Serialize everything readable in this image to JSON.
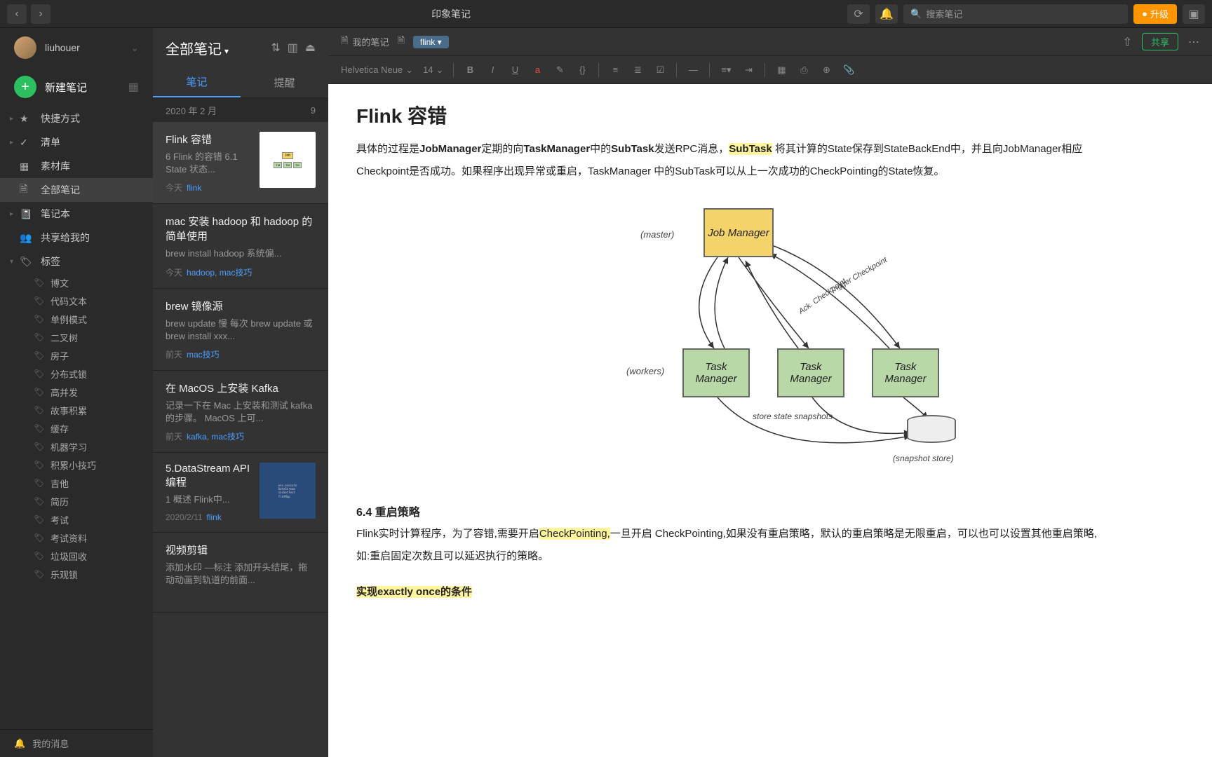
{
  "titlebar": {
    "app_title": "印象笔记",
    "search_placeholder": "搜索笔记",
    "upgrade": "升级"
  },
  "sidebar": {
    "username": "liuhouer",
    "new_note": "新建笔记",
    "items": [
      {
        "label": "快捷方式",
        "icon": "★"
      },
      {
        "label": "清单",
        "icon": "✓"
      },
      {
        "label": "素材库",
        "icon": "▦"
      },
      {
        "label": "全部笔记",
        "icon": "📄",
        "active": true
      },
      {
        "label": "笔记本",
        "icon": "📓"
      },
      {
        "label": "共享给我的",
        "icon": "👥"
      },
      {
        "label": "标签",
        "icon": "🏷"
      }
    ],
    "tags": [
      "博文",
      "代码文本",
      "单例模式",
      "二叉树",
      "房子",
      "分布式锁",
      "高并发",
      "故事积累",
      "缓存",
      "机器学习",
      "积累小技巧",
      "吉他",
      "简历",
      "考试",
      "考试资料",
      "垃圾回收",
      "乐观锁"
    ],
    "messages": "我的消息"
  },
  "notelist": {
    "title": "全部笔记",
    "tabs": [
      "笔记",
      "提醒"
    ],
    "date_header": "2020 年 2 月",
    "date_count": "9",
    "notes": [
      {
        "title": "Flink 容错",
        "snippet": "6 Flink 的容错 6.1 State 状态...",
        "date": "今天",
        "tags": "flink",
        "selected": true,
        "thumb": "diagram"
      },
      {
        "title": "mac 安装 hadoop 和 hadoop 的简单使用",
        "snippet": "brew install hadoop 系统偏...",
        "date": "今天",
        "tags": "hadoop, mac技巧"
      },
      {
        "title": "brew 镜像源",
        "snippet": "brew update 慢 每次 brew update 或 brew install xxx...",
        "date": "前天",
        "tags": "mac技巧"
      },
      {
        "title": "在 MacOS 上安装 Kafka",
        "snippet": "记录一下在 Mac 上安装和测试 kafka 的步骤。 MacOS 上可...",
        "date": "前天",
        "tags": "kafka, mac技巧"
      },
      {
        "title": "5.DataStream API 编程",
        "snippet": "1 概述 Flink中...",
        "date": "2020/2/11",
        "tags": "flink",
        "thumb": "code"
      },
      {
        "title": "视频剪辑",
        "snippet": "添加水印 —标注 添加开头结尾，拖动动画到轨道的前面...",
        "date": "",
        "tags": ""
      }
    ]
  },
  "editor": {
    "breadcrumb": {
      "notebook": "我的笔记",
      "tag": "flink"
    },
    "share": "共享",
    "toolbar": {
      "font": "Helvetica Neue",
      "size": "14"
    },
    "title": "Flink 容错",
    "body": {
      "p1_a": "具体的过程是",
      "p1_b": "JobManager",
      "p1_c": "定期的向",
      "p1_d": "TaskManager",
      "p1_e": "中的",
      "p1_f": "SubTask",
      "p1_g": "发送RPC消息，",
      "p1_h": "SubTask",
      "p1_i": " 将其计算的State保存到StateBackEnd中，并且向JobManager相应",
      "p2": "Checkpoint是否成功。如果程序出现异常或重启，TaskManager 中的SubTask可以从上一次成功的CheckPointing的State恢复。",
      "diagram": {
        "jm": "Job Manager",
        "tm": "Task Manager",
        "master": "(master)",
        "workers": "(workers)",
        "trigger": "Trigger Checkpoint",
        "ack": "Ack. Checkpoint",
        "store": "store state snapshots",
        "snapshot": "(snapshot store)"
      },
      "h64": "6.4 重启策略",
      "p3_a": "Flink实时计算程序，为了容错,需要开启",
      "p3_b": "CheckPointing,",
      "p3_c": "一旦开启 CheckPointing,如果没有重启策略，默认的重启策略是无限重启，可以也可以设置其他重启策略,",
      "p4": "如:重启固定次数且可以延迟执行的策略。",
      "h_exactly": "实现exactly once的条件"
    }
  }
}
